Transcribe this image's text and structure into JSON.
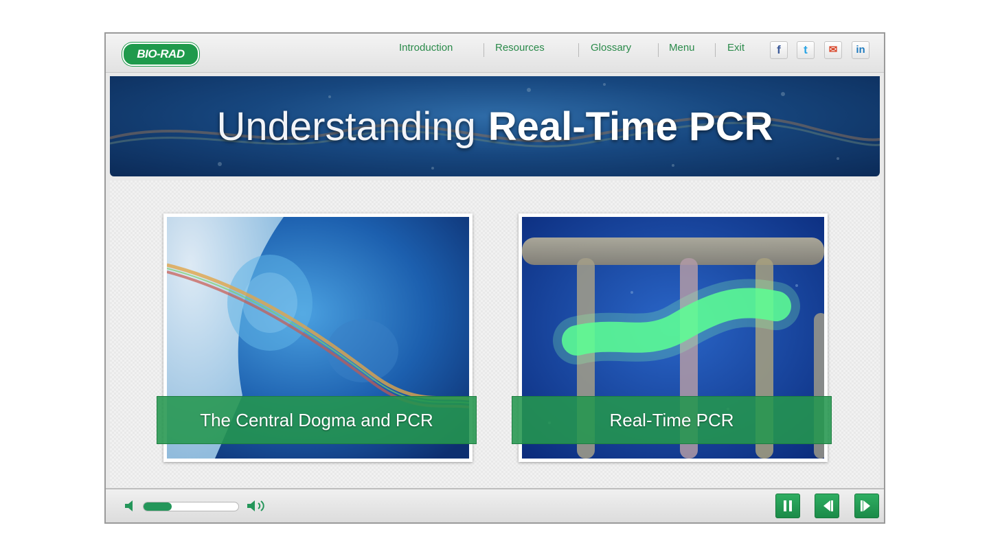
{
  "app": {
    "logo_text": "BIO-RAD",
    "nav": [
      "Introduction",
      "Resources",
      "Glossary",
      "Menu",
      "Exit"
    ],
    "social": [
      {
        "name": "facebook-icon",
        "glyph": "f",
        "color": "#3b5998"
      },
      {
        "name": "twitter-icon",
        "glyph": "t",
        "color": "#2aa4e4"
      },
      {
        "name": "email-icon",
        "glyph": "✉",
        "color": "#d9472b"
      },
      {
        "name": "linkedin-icon",
        "glyph": "in",
        "color": "#1f7bbf"
      }
    ]
  },
  "banner": {
    "title_light": "Understanding",
    "title_bold": "Real-Time PCR"
  },
  "cards": [
    {
      "label": "The Central Dogma and PCR"
    },
    {
      "label": "Real-Time PCR"
    }
  ],
  "player": {
    "volume_level": 0.3,
    "controls": [
      "pause-button",
      "previous-button",
      "next-button"
    ]
  },
  "colors": {
    "brand_green": "#1f9a4c",
    "nav_text": "#2a8a4a",
    "banner_blue": "#17477f",
    "label_green": "#24964e"
  }
}
